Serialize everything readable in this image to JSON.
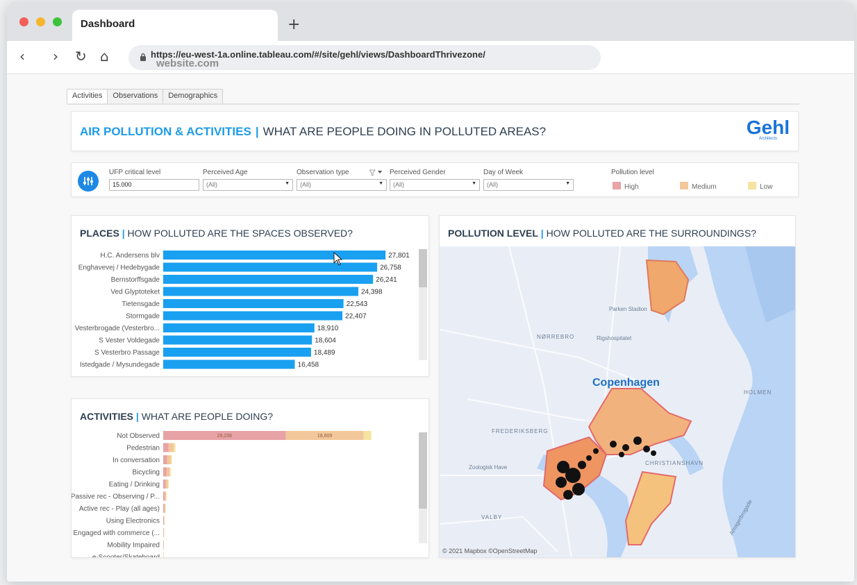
{
  "browser": {
    "tab_title": "Dashboard",
    "new_tab": "+",
    "url": "https://eu-west-1a.online.tableau.com/#/site/gehl/views/DashboardThrivezone/",
    "ghost_text": "website.com",
    "nav": {
      "back": "‹",
      "forward": "›",
      "reload": "↻",
      "home": "⌂"
    }
  },
  "dashboard_tabs": [
    "Activities",
    "Observations",
    "Demographics"
  ],
  "header": {
    "title_accent": "AIR POLLUTION & ACTIVITIES",
    "separator": "|",
    "title_rest": "WHAT ARE PEOPLE DOING IN POLLUTED AREAS?",
    "logo": "Gehl",
    "logo_sub": "Architects"
  },
  "filters": {
    "ufp": {
      "label": "UFP critical level",
      "value": "15.000"
    },
    "age": {
      "label": "Perceived Age",
      "value": "(All)"
    },
    "obs_type": {
      "label": "Observation type",
      "value": "(All)"
    },
    "gender": {
      "label": "Perceived Gender",
      "value": "(All)"
    },
    "day": {
      "label": "Day of Week",
      "value": "(All)"
    },
    "pollution": {
      "label": "Pollution level",
      "items": [
        {
          "name": "High",
          "color": "#e8a3a6"
        },
        {
          "name": "Medium",
          "color": "#f2c79a"
        },
        {
          "name": "Low",
          "color": "#f5e3a0"
        }
      ]
    }
  },
  "places": {
    "title_bold": "PLACES",
    "separator": "|",
    "title_rest": "HOW POLLUTED ARE THE SPACES OBSERVED?"
  },
  "activities": {
    "title_bold": "ACTIVITIES",
    "separator": "|",
    "title_rest": "WHAT ARE PEOPLE DOING?"
  },
  "map": {
    "title_bold": "POLLUTION LEVEL",
    "separator": "|",
    "title_rest": "HOW POLLUTED ARE THE SURROUNDINGS?",
    "city": "Copenhagen",
    "labels": [
      "NØRREBRO",
      "Parken Stadion",
      "Rigshospitalet",
      "FREDERIKSBERG",
      "Zoologisk Have",
      "VALBY",
      "CHRISTIANSHAVN",
      "HOLMEN",
      "Amagerbrogade"
    ],
    "credit": "© 2021 Mapbox ©OpenStreetMap"
  },
  "chart_data": [
    {
      "type": "bar",
      "orientation": "horizontal",
      "categories": [
        "H.C. Andersens blv",
        "Enghavevej / Hedebygade",
        "Bernstorffsgade",
        "Ved Glyptoteket",
        "Tietensgade",
        "Stormgade",
        "Vesterbrogade (Vesterbro...",
        "S Vester Voldegade",
        "S Vesterbro Passage",
        "Istedgade / Mysundegade"
      ],
      "values": [
        27801,
        26758,
        26241,
        24398,
        22543,
        22407,
        18910,
        18604,
        18489,
        16458
      ],
      "value_labels": [
        "27,801",
        "26,758",
        "26,241",
        "24,398",
        "22,543",
        "22,407",
        "18,910",
        "18,604",
        "18,489",
        "16,458"
      ],
      "bar_color": "#1aa0f0",
      "xlim": [
        0,
        33000
      ]
    },
    {
      "type": "bar",
      "orientation": "horizontal",
      "stacked": true,
      "categories": [
        "Not Observed",
        "Pedestrian",
        "In conversation",
        "Bicycling",
        "Eating / Drinking",
        "Passive rec - Observing / P...",
        "Active rec - Play (all ages)",
        "Using Electronics",
        "Engaged with commerce (...",
        "Mobility Impaired",
        "e-Scooter/Skateboard"
      ],
      "series": [
        {
          "name": "High",
          "color": "#e8a3a6",
          "values": [
            29239,
            1300,
            900,
            850,
            600,
            400,
            300,
            150,
            100,
            80,
            60
          ]
        },
        {
          "name": "Medium",
          "color": "#f2c79a",
          "values": [
            18609,
            1200,
            900,
            700,
            500,
            300,
            200,
            120,
            80,
            60,
            40
          ]
        },
        {
          "name": "Low",
          "color": "#f5e3a0",
          "values": [
            1800,
            400,
            300,
            250,
            200,
            100,
            80,
            50,
            30,
            20,
            20
          ]
        }
      ],
      "data_labels": [
        "29,239",
        "18,609"
      ],
      "xlim": [
        0,
        58000
      ]
    }
  ]
}
